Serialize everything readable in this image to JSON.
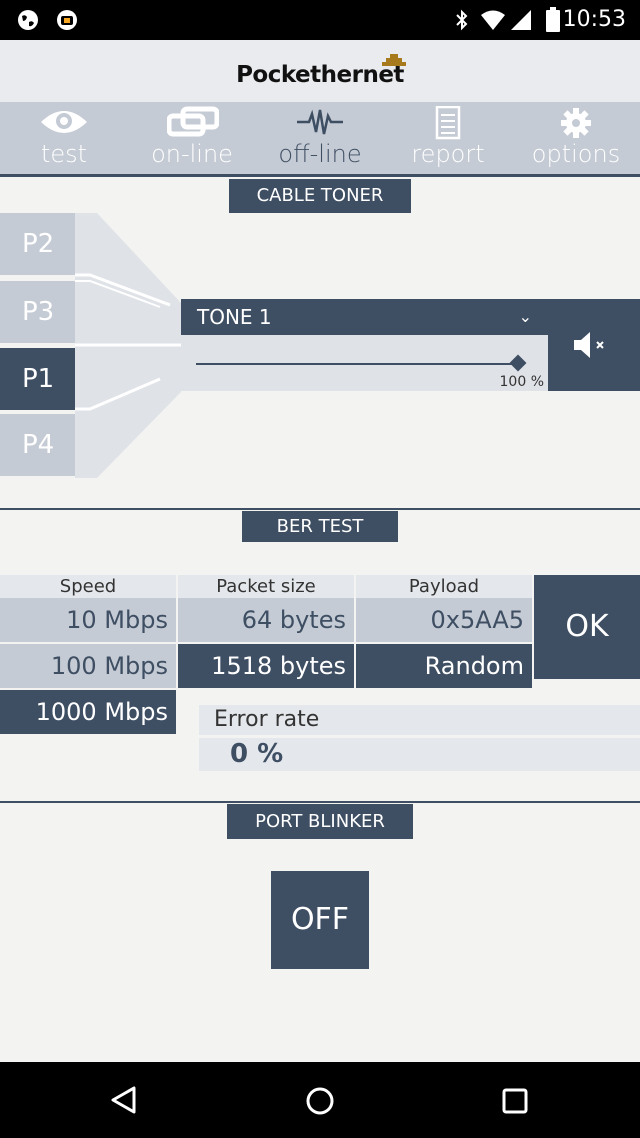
{
  "status_bar": {
    "time": "10:53",
    "icons": [
      "globe-icon",
      "app-icon",
      "bluetooth-icon",
      "wifi-icon",
      "signal-icon",
      "battery-icon"
    ]
  },
  "header": {
    "logo_text": "Pockethernet"
  },
  "tabs": [
    {
      "label": "test",
      "icon": "eye-icon"
    },
    {
      "label": "on-line",
      "icon": "link-icon"
    },
    {
      "label": "off-line",
      "icon": "waveform-icon",
      "active": true
    },
    {
      "label": "report",
      "icon": "document-icon"
    },
    {
      "label": "options",
      "icon": "gear-icon"
    }
  ],
  "cable_toner": {
    "title": "CABLE TONER",
    "ports": [
      {
        "label": "P2",
        "active": false
      },
      {
        "label": "P3",
        "active": false
      },
      {
        "label": "P1",
        "active": true
      },
      {
        "label": "P4",
        "active": false
      }
    ],
    "tone_selected": "TONE 1",
    "volume_fraction": 1.0,
    "volume_label": "100 %"
  },
  "ber_test": {
    "title": "BER TEST",
    "speed": {
      "header": "Speed",
      "options": [
        "10 Mbps",
        "100 Mbps",
        "1000 Mbps"
      ],
      "selected": "1000 Mbps"
    },
    "packet_size": {
      "header": "Packet size",
      "options": [
        "64 bytes",
        "1518 bytes"
      ],
      "selected": "1518 bytes"
    },
    "payload": {
      "header": "Payload",
      "options": [
        "0x5AA5",
        "Random"
      ],
      "selected": "Random"
    },
    "ok_label": "OK",
    "error_rate_label": "Error rate",
    "error_rate_value": "0 %"
  },
  "port_blinker": {
    "title": "PORT BLINKER",
    "button_label": "OFF"
  },
  "colors": {
    "accent": "#3e4e63",
    "light": "#c5cbd4",
    "background": "#f3f3f1"
  }
}
